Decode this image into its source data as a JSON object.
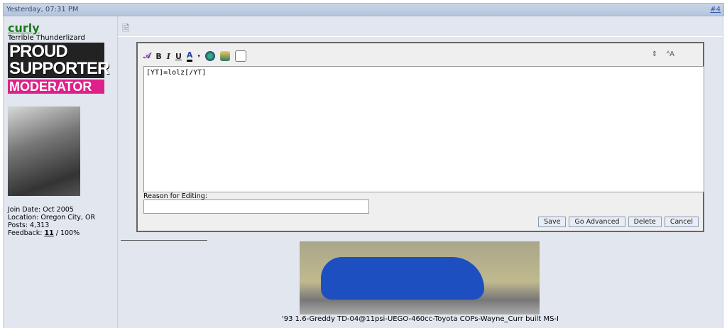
{
  "post": {
    "date": "Yesterday, 07:31 PM",
    "number": "#4"
  },
  "user": {
    "name": "curly",
    "title": "Terrible Thunderlizard",
    "badge_line1": "PROUD SUPPORTER",
    "badge_line2": "MODERATOR",
    "join_date": "Join Date: Oct 2005",
    "location": "Location: Oregon City, OR",
    "posts": "Posts: 4,313",
    "feedback_label": "Feedback: ",
    "feedback_count": "11",
    "feedback_pct": " / 100%"
  },
  "editor": {
    "content": "[YT]=lolz[/YT]",
    "reason_label": "Reason for Editing:",
    "reason_value": "",
    "toolbar": {
      "bold": "B",
      "italic": "I",
      "underline": "U",
      "font_color": "A"
    },
    "buttons": {
      "save": "Save",
      "advanced": "Go Advanced",
      "delete": "Delete",
      "cancel": "Cancel"
    }
  },
  "signature": {
    "caption": "'93 1.6-Greddy TD-04@11psi-UEGO-460cc-Toyota COPs-Wayne_Curr built MS-I"
  }
}
